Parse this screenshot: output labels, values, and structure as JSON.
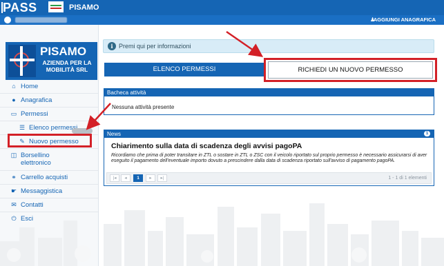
{
  "header": {
    "brand": "PASS",
    "app_name": "PISAMO",
    "add_anagrafica_label": "AGGIUNGI ANAGRAFICA"
  },
  "sidebar": {
    "logo": {
      "title": "PISAMO",
      "subtitle": "AZIENDA PER LA MOBILITÀ SRL"
    },
    "items": [
      {
        "label": "Home",
        "icon": "home-icon"
      },
      {
        "label": "Anagrafica",
        "icon": "user-icon"
      },
      {
        "label": "Permessi",
        "icon": "folder-open-icon"
      },
      {
        "label": "Elenco permessi",
        "icon": "list-icon"
      },
      {
        "label": "Nuovo permesso",
        "icon": "new-document-icon"
      },
      {
        "label": "Borsellino elettronico",
        "icon": "wallet-icon"
      },
      {
        "label": "Carrello acquisti",
        "icon": "cart-icon"
      },
      {
        "label": "Messaggistica",
        "icon": "handshake-icon"
      },
      {
        "label": "Contatti",
        "icon": "envelope-icon"
      },
      {
        "label": "Esci",
        "icon": "power-icon"
      }
    ]
  },
  "main": {
    "info_text": "Premi qui per informazioni",
    "elenco_button": "ELENCO PERMESSI",
    "richiedi_button": "RICHIEDI UN NUOVO PERMESSO",
    "bacheca": {
      "title": "Bacheca attività",
      "text": "Nessuna attività presente"
    },
    "news": {
      "title": "News",
      "count": "1",
      "headline": "Chiarimento sulla data di scadenza degli avvisi pagoPA",
      "body": "Ricordiamo che prima di poter transitare in ZTL o sostare in ZTL o ZSC con il veicolo riportato sul proprio permesso è necessario assicurarsi di aver eseguito il pagamento dell'eventuale importo dovuto a prescindere dalla data di scadenza riportato sull'avviso di pagamento pagoPA.",
      "pager": {
        "first": "|◂",
        "prev": "◂",
        "page": "1",
        "next": "▸",
        "last": "▸|",
        "info": "1 - 1 di 1 elementi"
      }
    }
  },
  "colors": {
    "primary": "#1565b4",
    "highlight": "#d32027"
  }
}
